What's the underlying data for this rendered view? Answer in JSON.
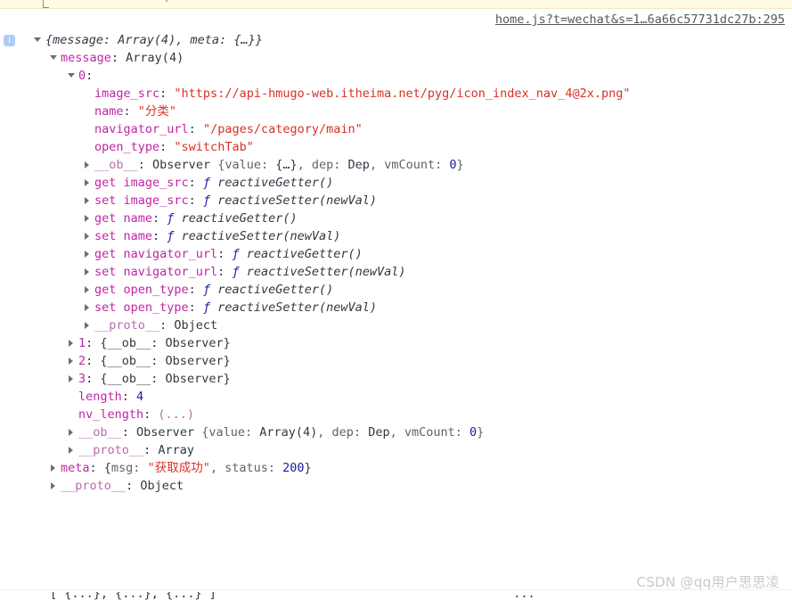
{
  "console": {
    "warning_strip": {
      "visible": true,
      "color": "#fffbe5"
    },
    "source_link": "home.js?t=wechat&s=1…6a66c57731dc27b:295",
    "info_badge": "i",
    "root": {
      "preview": "{message: Array(4), meta: {…}}",
      "expanded": true
    },
    "rows": [
      {
        "indent": 1,
        "arrow": "open",
        "name": "message",
        "name_style": "prop",
        "sep": ": ",
        "value": "Array(4)",
        "value_style": "plain"
      },
      {
        "indent": 2,
        "arrow": "open",
        "name": "0",
        "name_style": "prop",
        "sep": ":",
        "value": "",
        "value_style": "plain"
      },
      {
        "indent": 3,
        "arrow": "none",
        "name": "image_src",
        "name_style": "prop",
        "sep": ": ",
        "value": "\"https://api-hmugo-web.itheima.net/pyg/icon_index_nav_4@2x.png\"",
        "value_style": "string"
      },
      {
        "indent": 3,
        "arrow": "none",
        "name": "name",
        "name_style": "prop",
        "sep": ": ",
        "value": "\"分类\"",
        "value_style": "string"
      },
      {
        "indent": 3,
        "arrow": "none",
        "name": "navigator_url",
        "name_style": "prop",
        "sep": ": ",
        "value": "\"/pages/category/main\"",
        "value_style": "string"
      },
      {
        "indent": 3,
        "arrow": "none",
        "name": "open_type",
        "name_style": "prop",
        "sep": ": ",
        "value": "\"switchTab\"",
        "value_style": "string"
      },
      {
        "indent": 3,
        "arrow": "closed",
        "name": "__ob__",
        "name_style": "dim",
        "sep": ": ",
        "value": "Observer {value: {…}, dep: Dep, vmCount: 0}",
        "value_style": "observer-obj"
      },
      {
        "indent": 3,
        "arrow": "closed",
        "name": "get image_src",
        "name_style": "prop",
        "sep": ": ",
        "value": "ƒ reactiveGetter()",
        "value_style": "function"
      },
      {
        "indent": 3,
        "arrow": "closed",
        "name": "set image_src",
        "name_style": "prop",
        "sep": ": ",
        "value": "ƒ reactiveSetter(newVal)",
        "value_style": "function"
      },
      {
        "indent": 3,
        "arrow": "closed",
        "name": "get name",
        "name_style": "prop",
        "sep": ": ",
        "value": "ƒ reactiveGetter()",
        "value_style": "function"
      },
      {
        "indent": 3,
        "arrow": "closed",
        "name": "set name",
        "name_style": "prop",
        "sep": ": ",
        "value": "ƒ reactiveSetter(newVal)",
        "value_style": "function"
      },
      {
        "indent": 3,
        "arrow": "closed",
        "name": "get navigator_url",
        "name_style": "prop",
        "sep": ": ",
        "value": "ƒ reactiveGetter()",
        "value_style": "function"
      },
      {
        "indent": 3,
        "arrow": "closed",
        "name": "set navigator_url",
        "name_style": "prop",
        "sep": ": ",
        "value": "ƒ reactiveSetter(newVal)",
        "value_style": "function"
      },
      {
        "indent": 3,
        "arrow": "closed",
        "name": "get open_type",
        "name_style": "prop",
        "sep": ": ",
        "value": "ƒ reactiveGetter()",
        "value_style": "function"
      },
      {
        "indent": 3,
        "arrow": "closed",
        "name": "set open_type",
        "name_style": "prop",
        "sep": ": ",
        "value": "ƒ reactiveSetter(newVal)",
        "value_style": "function"
      },
      {
        "indent": 3,
        "arrow": "closed",
        "name": "__proto__",
        "name_style": "dim",
        "sep": ": ",
        "value": "Object",
        "value_style": "plain"
      },
      {
        "indent": 2,
        "arrow": "closed",
        "name": "1",
        "name_style": "prop",
        "sep": ": ",
        "value": "{__ob__: Observer}",
        "value_style": "plain"
      },
      {
        "indent": 2,
        "arrow": "closed",
        "name": "2",
        "name_style": "prop",
        "sep": ": ",
        "value": "{__ob__: Observer}",
        "value_style": "plain"
      },
      {
        "indent": 2,
        "arrow": "closed",
        "name": "3",
        "name_style": "prop",
        "sep": ": ",
        "value": "{__ob__: Observer}",
        "value_style": "plain"
      },
      {
        "indent": 2,
        "arrow": "none",
        "name": "length",
        "name_style": "prop",
        "sep": ": ",
        "value": "4",
        "value_style": "number"
      },
      {
        "indent": 2,
        "arrow": "none",
        "name": "nv_length",
        "name_style": "prop",
        "sep": ": ",
        "value": "(...)",
        "value_style": "ellipsis"
      },
      {
        "indent": 2,
        "arrow": "closed",
        "name": "__ob__",
        "name_style": "dim",
        "sep": ": ",
        "value": "Observer {value: Array(4), dep: Dep, vmCount: 0}",
        "value_style": "observer-arr"
      },
      {
        "indent": 2,
        "arrow": "closed",
        "name": "__proto__",
        "name_style": "dim",
        "sep": ": ",
        "value": "Array",
        "value_style": "plain"
      },
      {
        "indent": 1,
        "arrow": "closed",
        "name": "meta",
        "name_style": "prop",
        "sep": ": ",
        "value": "{msg: \"获取成功\", status: 200}",
        "value_style": "meta-obj"
      },
      {
        "indent": 1,
        "arrow": "closed",
        "name": "__proto__",
        "name_style": "dim",
        "sep": ": ",
        "value": "Object",
        "value_style": "plain"
      }
    ],
    "observer_obj_parts": {
      "class": "Observer ",
      "open": "{",
      "p1_key": "value: ",
      "p1_val": "{…}",
      "sep1": ", ",
      "p2_key": "dep: ",
      "p2_val": "Dep",
      "sep2": ", ",
      "p3_key": "vmCount: ",
      "p3_val": "0",
      "close": "}"
    },
    "observer_arr_parts": {
      "class": "Observer ",
      "open": "{",
      "p1_key": "value: ",
      "p1_val": "Array(4)",
      "sep1": ", ",
      "p2_key": "dep: ",
      "p2_val": "Dep",
      "sep2": ", ",
      "p3_key": "vmCount: ",
      "p3_val": "0",
      "close": "}"
    },
    "meta_obj_parts": {
      "open": "{",
      "k1": "msg: ",
      "v1": "\"获取成功\"",
      "sep": ", ",
      "k2": "status: ",
      "v2": "200",
      "close": "}"
    },
    "next_entry": {
      "left": "[ {...}, {...}, {...} ]",
      "right": "\"\"..."
    }
  },
  "watermark": "CSDN @qq用户思思凌",
  "colors": {
    "property": "#c026a3",
    "property_dim": "#b86bb0",
    "string": "#d93025",
    "number": "#1a1aa6",
    "preview_gray": "#5f6368",
    "internal_gray": "#9aa0a6",
    "badge": "#aecbfa",
    "warning_bg": "#fffbe5",
    "text": "#303942"
  }
}
